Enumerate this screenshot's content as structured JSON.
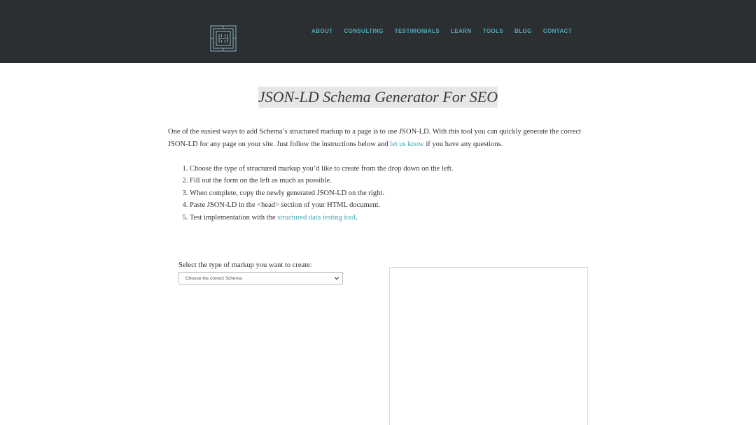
{
  "header": {
    "logo_icon": "hh-maze-logo-icon",
    "colors": {
      "background": "#2b2f32",
      "nav_link": "#4fa9b8"
    },
    "nav": [
      {
        "label": "ABOUT"
      },
      {
        "label": "CONSULTING"
      },
      {
        "label": "TESTIMONIALS"
      },
      {
        "label": "LEARN"
      },
      {
        "label": "TOOLS"
      },
      {
        "label": "BLOG"
      },
      {
        "label": "CONTACT"
      }
    ]
  },
  "main": {
    "title": "JSON-LD Schema Generator For SEO",
    "intro": {
      "text_before": "One of the easiest ways to add Schema’s structured markup to a page is to use JSON-LD. With this tool you can quickly generate the correct JSON-LD for any page on your site. Just follow the instructions below and ",
      "link_text": "let us know",
      "text_after": " if you have any questions."
    },
    "steps": [
      {
        "text": "Choose the type of structured markup you’d like to create from the drop down on the left."
      },
      {
        "text": "Fill out the form on the left as much as possible."
      },
      {
        "text": "When complete, copy the newly generated JSON-LD on the right."
      },
      {
        "text": "Paste JSON-LD in the <head> section of your HTML document."
      },
      {
        "text_before": "Test implementation with the ",
        "link_text": "structured data testing tool",
        "text_after": "."
      }
    ],
    "select": {
      "label": "Select the type of markup you want to create:",
      "selected": "Choose the correct Schema",
      "arrow_icon": "chevron-down-icon"
    },
    "output": {
      "value": ""
    },
    "link_color": "#3fa5b1"
  }
}
